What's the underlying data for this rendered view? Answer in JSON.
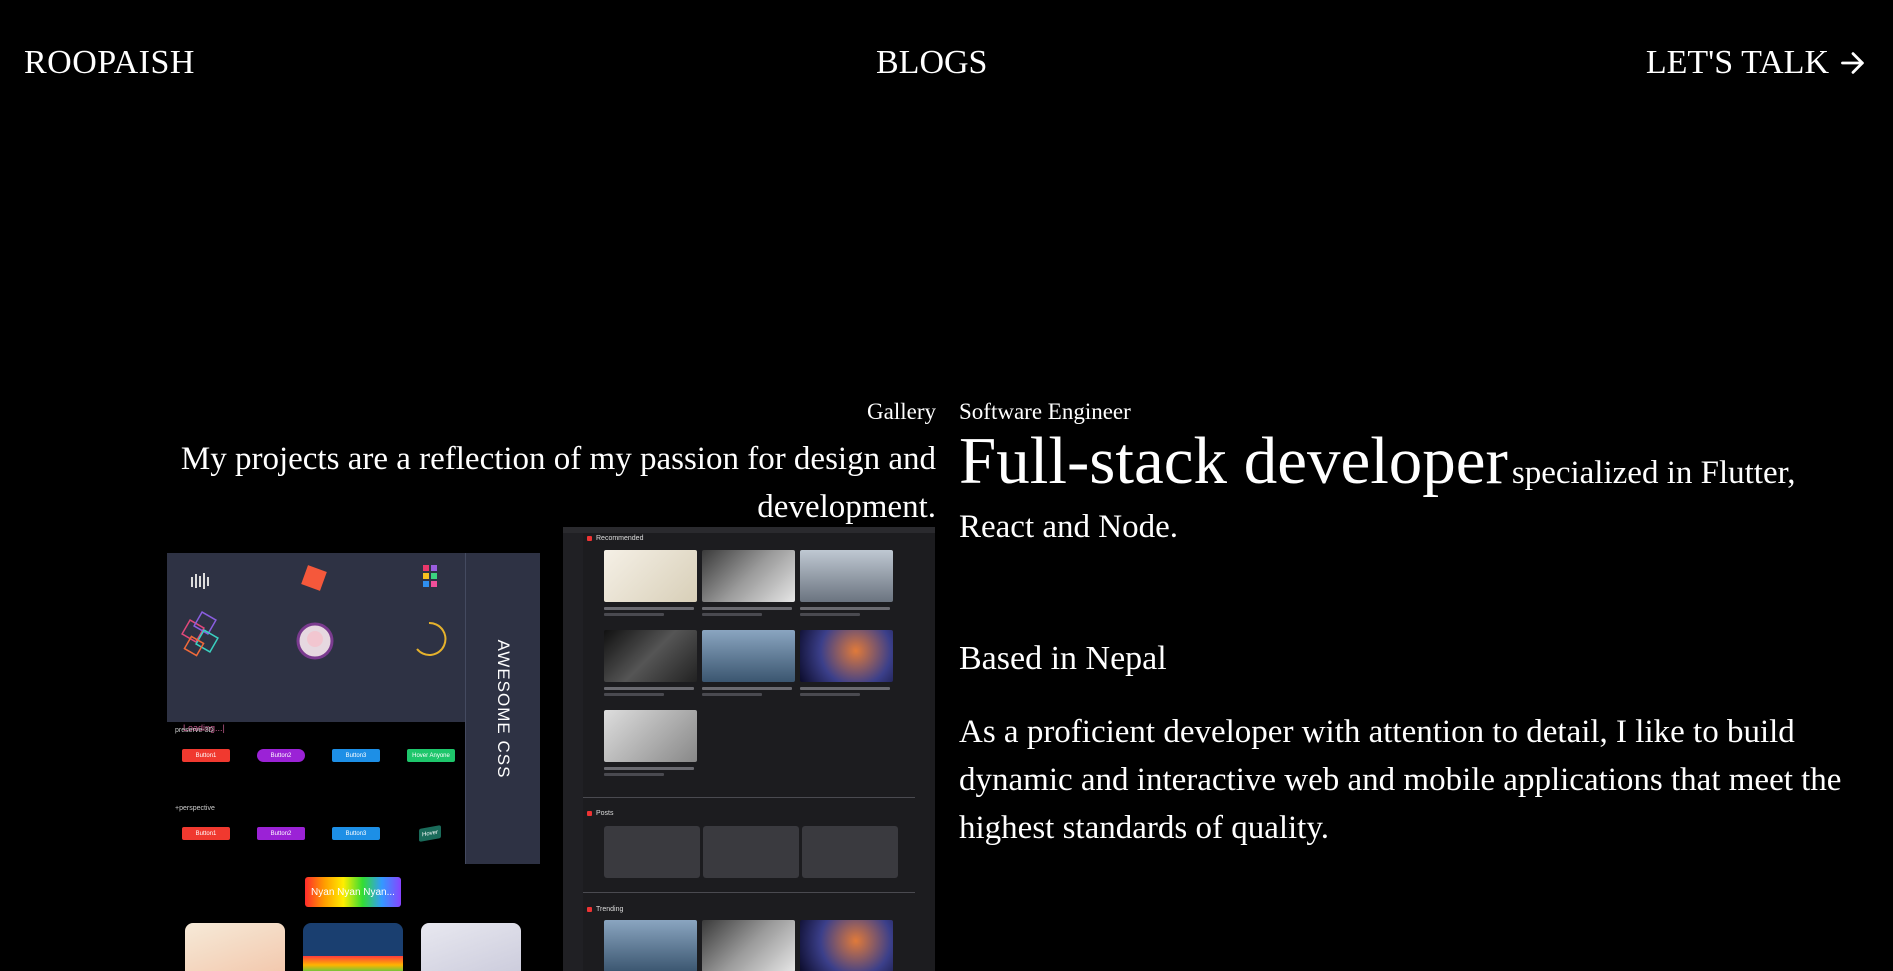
{
  "nav": {
    "logo": "ROOPAISH",
    "blogs": "BLOGS",
    "talk": "LET'S TALK",
    "talk_icon": "arrow-right-icon"
  },
  "gallery": {
    "label": "Gallery",
    "description": "My projects are a reflection of my passion for design and development.",
    "css_project": {
      "title": "AWESOME CSS",
      "loading": "Loading...|",
      "row1_label": "preserve-3D",
      "row2_label": "+perspective",
      "buttons_row1": [
        "Button1",
        "Button2",
        "Button3",
        "Hover Anyone"
      ],
      "buttons_row2": [
        "Button1",
        "Button2",
        "Button3",
        "Hover"
      ],
      "nyan_label": "Nyan Nyan Nyan...",
      "colors": {
        "red": "#f0392f",
        "purple": "#9b22d6",
        "blue": "#1d8fe6",
        "green": "#1ec66b",
        "panel": "#2e3244"
      }
    },
    "yt_project": {
      "sections": [
        "Recommended",
        "Posts",
        "Trending"
      ]
    }
  },
  "about": {
    "role": "Software Engineer",
    "headline_big": "Full-stack developer",
    "headline_small": "specialized in Flutter, React and Node.",
    "location": "Based in Nepal",
    "bio": "As a proficient developer with attention to detail, I like to build dynamic and interactive web and mobile applications that meet the highest standards of quality."
  }
}
